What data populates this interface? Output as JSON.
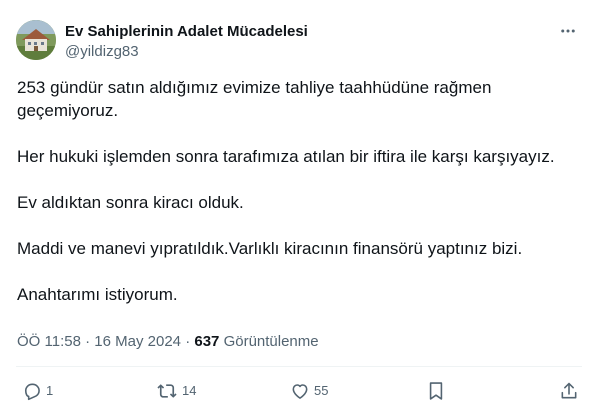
{
  "author": {
    "display_name": "Ev Sahiplerinin Adalet Mücadelesi",
    "handle": "@yildizg83"
  },
  "tweet": {
    "paragraphs": [
      "253 gündür satın aldığımız evimize tahliye taahhüdüne rağmen geçemiyoruz.",
      "Her hukuki işlemden sonra tarafımıza atılan bir iftira ile karşı karşıyayız.",
      "Ev aldıktan sonra kiracı olduk.",
      "Maddi ve manevi yıpratıldık.Varlıklı kiracının finansörü yaptınız bizi.",
      "Anahtarımı istiyorum."
    ]
  },
  "meta": {
    "time": "ÖÖ 11:58",
    "separator": "·",
    "date": "16 May 2024",
    "views_count": "637",
    "views_label": "Görüntülenme"
  },
  "actions": {
    "reply_count": "1",
    "retweet_count": "14",
    "like_count": "55"
  },
  "icons": {
    "more": "more-horizontal-icon",
    "reply": "reply-icon",
    "retweet": "retweet-icon",
    "like": "heart-icon",
    "bookmark": "bookmark-icon",
    "share": "share-icon"
  },
  "colors": {
    "text_primary": "#0f1419",
    "text_secondary": "#536471",
    "divider": "#eff3f4"
  }
}
